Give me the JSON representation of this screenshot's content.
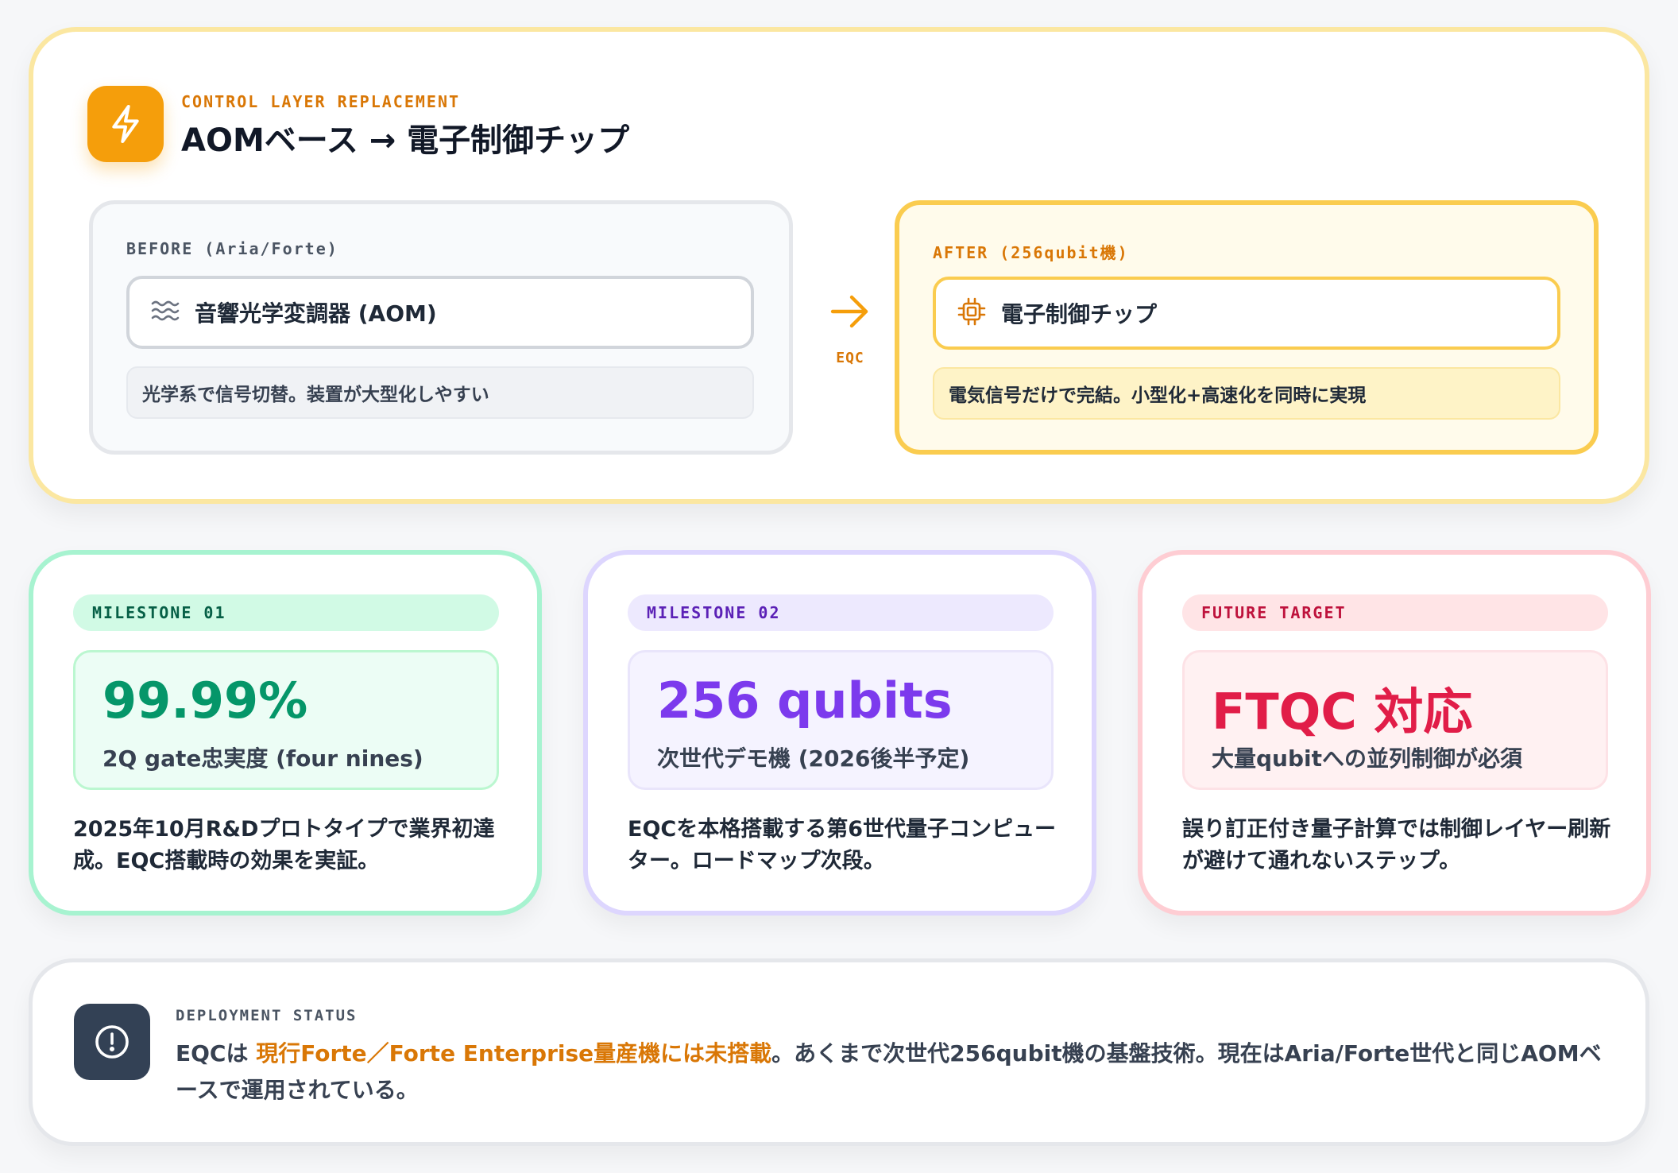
{
  "control_layer": {
    "kicker": "CONTROL LAYER REPLACEMENT",
    "title": "AOMベース → 電子制御チップ",
    "icon": "lightning-icon",
    "accent_color": "#f59e0b",
    "before": {
      "label": "BEFORE (Aria/Forte)",
      "item": "音響光学変調器 (AOM)",
      "item_icon": "waves-icon",
      "note": "光学系で信号切替。装置が大型化しやすい"
    },
    "transition": {
      "icon": "arrow-right-icon",
      "label": "EQC"
    },
    "after": {
      "label": "AFTER (256qubit機)",
      "item": "電子制御チップ",
      "item_icon": "chip-icon",
      "note": "電気信号だけで完結。小型化+高速化を同時に実現"
    }
  },
  "milestones": [
    {
      "tag": "MILESTONE 01",
      "value": "99.99%",
      "subtitle": "2Q gate忠実度 (four nines)",
      "description": "2025年10月R&Dプロトタイプで業界初達成。EQC搭載時の効果を実証。",
      "color": "#059669"
    },
    {
      "tag": "MILESTONE 02",
      "value": "256 qubits",
      "subtitle": "次世代デモ機 (2026後半予定)",
      "description": "EQCを本格搭載する第6世代量子コンピューター。ロードマップ次段。",
      "color": "#7c3aed"
    },
    {
      "tag": "FUTURE TARGET",
      "value": "FTQC 対応",
      "subtitle": "大量qubitへの並列制御が必須",
      "description": "誤り訂正付き量子計算では制御レイヤー刷新が避けて通れないステップ。",
      "color": "#e11d48"
    }
  ],
  "deployment": {
    "label": "DEPLOYMENT STATUS",
    "icon": "alert-circle-icon",
    "text_prefix": "EQCは ",
    "text_highlight": "現行Forte／Forte Enterprise量産機には未搭載",
    "text_suffix": "。あくまで次世代256qubit機の基盤技術。現在はAria/Forte世代と同じAOMベースで運用されている。",
    "highlight_color": "#d97706"
  }
}
